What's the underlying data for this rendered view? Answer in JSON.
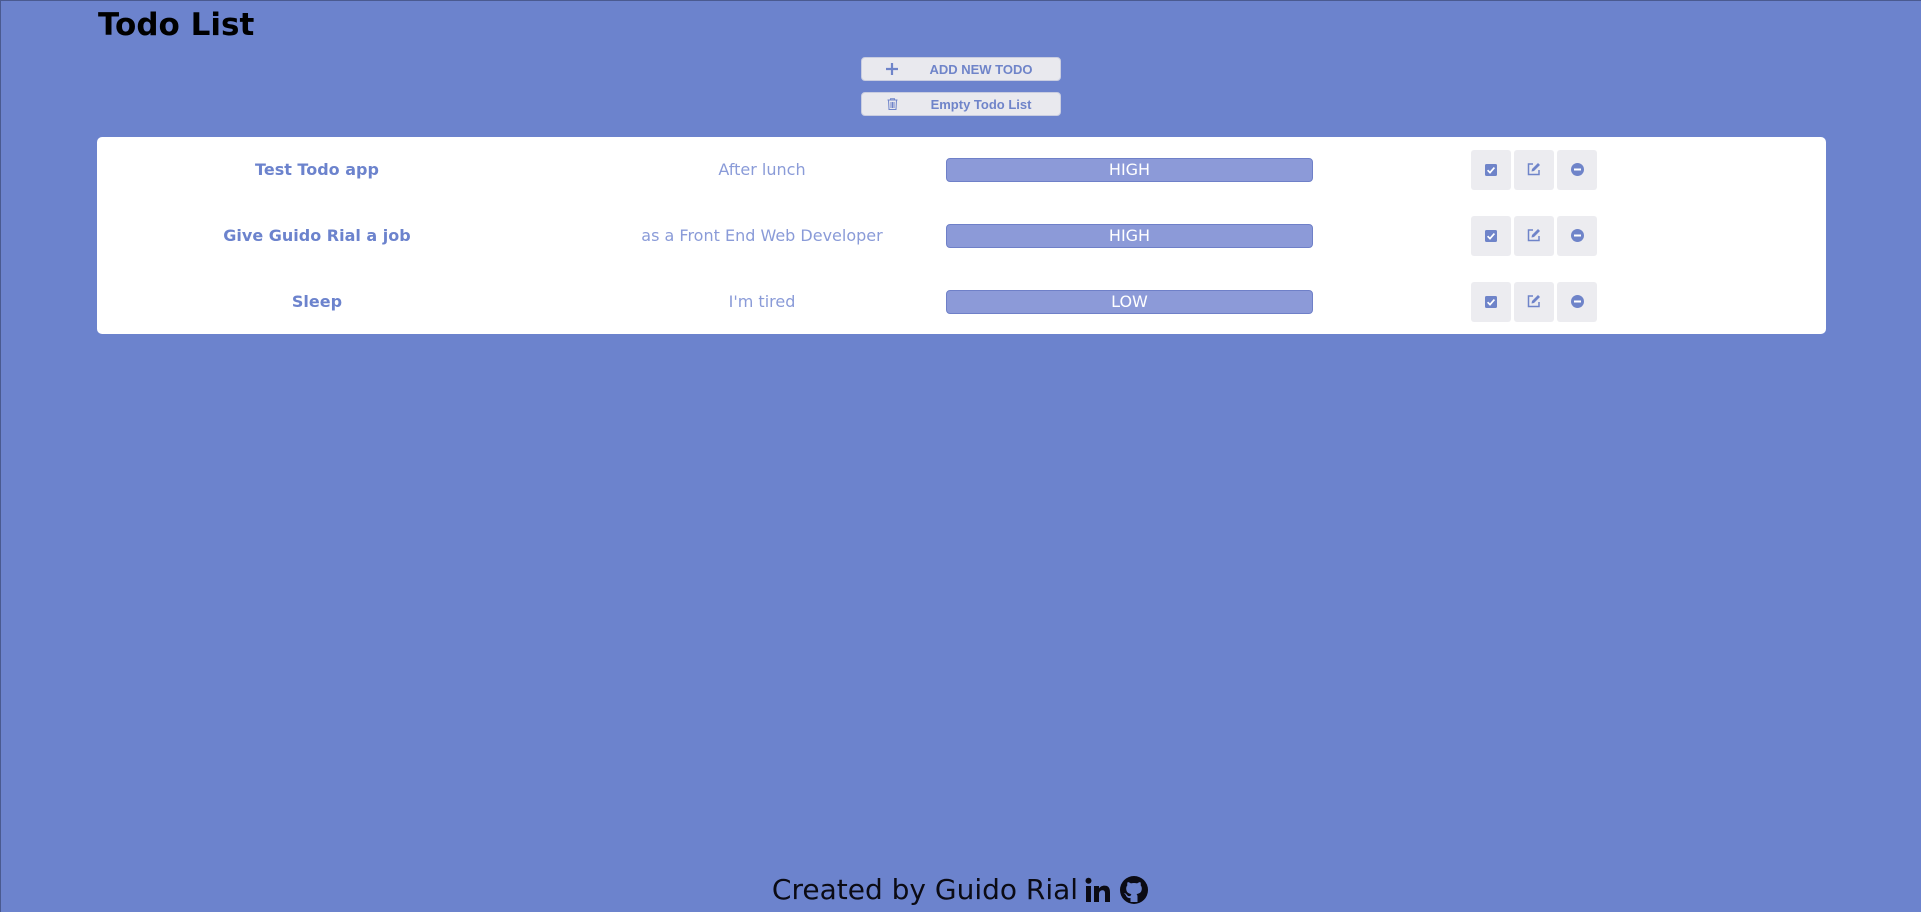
{
  "page": {
    "title": "Todo List"
  },
  "actions": {
    "add_label": "ADD NEW TODO",
    "empty_label": "Empty Todo List",
    "add_icon": "plus-icon",
    "empty_icon": "trash-icon"
  },
  "todos": [
    {
      "title": "Test Todo app",
      "description": "After lunch",
      "priority": "HIGH"
    },
    {
      "title": "Give Guido Rial a job",
      "description": "as a Front End Web Developer",
      "priority": "HIGH"
    },
    {
      "title": "Sleep",
      "description": "I'm tired",
      "priority": "LOW"
    }
  ],
  "row_actions": {
    "complete_icon": "check-square-icon",
    "edit_icon": "edit-icon",
    "remove_icon": "minus-circle-icon"
  },
  "footer": {
    "text": "Created by Guido Rial",
    "icons": [
      "linkedin-icon",
      "github-icon"
    ]
  },
  "colors": {
    "background": "#6c83cd",
    "card": "#ffffff",
    "accent": "#6c83cd",
    "priority_bar": "#8c9ad8",
    "button_bg": "#e9e9ee"
  }
}
